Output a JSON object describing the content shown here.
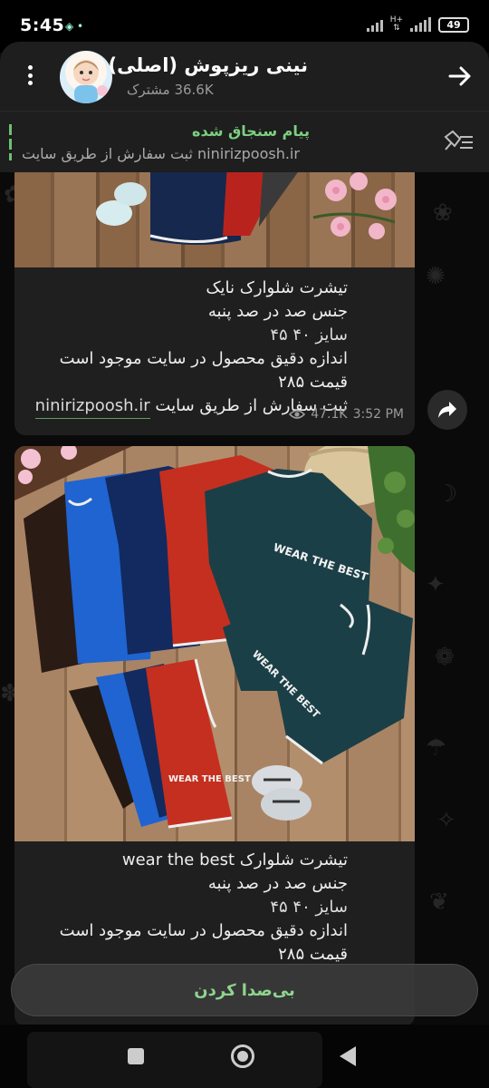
{
  "status_bar": {
    "time": "5:45",
    "network_label": "H+",
    "battery": "49"
  },
  "header": {
    "channel_name": "نینی ریزپوش (اصلی)",
    "subscribers_count": "36.6K",
    "subscribers_label": "مشترک"
  },
  "pinned": {
    "title": "پیام سنجاق شده",
    "text": "ninirizpoosh.ir ثبت سفارش از طریق سایت"
  },
  "posts": [
    {
      "lines": [
        "تیشرت شلوارک نایک",
        "جنس صد در صد پنبه",
        "سایز ۴۰ ۴۵",
        "اندازه دقیق محصول در سایت موجود است",
        "قیمت ۲۸۵"
      ],
      "link_prefix": "ثبت سفارش از طریق سایت",
      "link": "ninirizpoosh.ir",
      "views": "47.1K",
      "time": "3:52 PM"
    },
    {
      "lines": [
        "تیشرت شلوارک wear the best",
        "جنس صد در صد پنبه",
        "سایز ۴۰ ۴۵",
        "اندازه دقیق محصول در سایت موجود است",
        "قیمت ۲۸۵"
      ],
      "print_text": "WEAR THE BEST"
    }
  ],
  "mute_button": "بی‌صدا کردن",
  "colors": {
    "accent_green": "#7bcf7f",
    "bubble_bg": "#1f1f1f",
    "header_bg": "#1e1e1e"
  }
}
